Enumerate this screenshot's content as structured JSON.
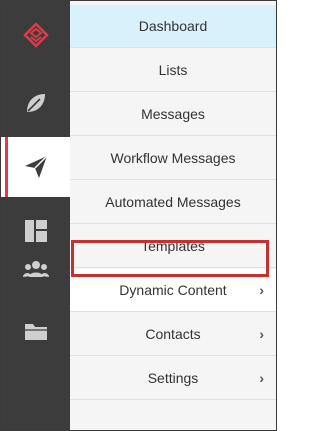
{
  "colors": {
    "rail_bg": "#3c3c3c",
    "accent": "#e03a4a",
    "active_bg": "#d9f1fb",
    "highlight_border": "#c63031"
  },
  "rail": [
    {
      "icon": "logo-icon"
    },
    {
      "icon": "leaf-icon"
    },
    {
      "icon": "send-icon",
      "active": true
    },
    {
      "icon": "dashboard-grid-icon"
    },
    {
      "icon": "users-icon"
    },
    {
      "icon": "folder-icon"
    }
  ],
  "menu": {
    "items": [
      {
        "label": "Dashboard",
        "active": true
      },
      {
        "label": "Lists"
      },
      {
        "label": "Messages"
      },
      {
        "label": "Workflow Messages"
      },
      {
        "label": "Automated Messages"
      },
      {
        "label": "Templates"
      },
      {
        "label": "Dynamic Content",
        "chevron": "›",
        "highlighted": true
      },
      {
        "label": "Contacts",
        "chevron": "›"
      },
      {
        "label": "Settings",
        "chevron": "›"
      }
    ]
  }
}
